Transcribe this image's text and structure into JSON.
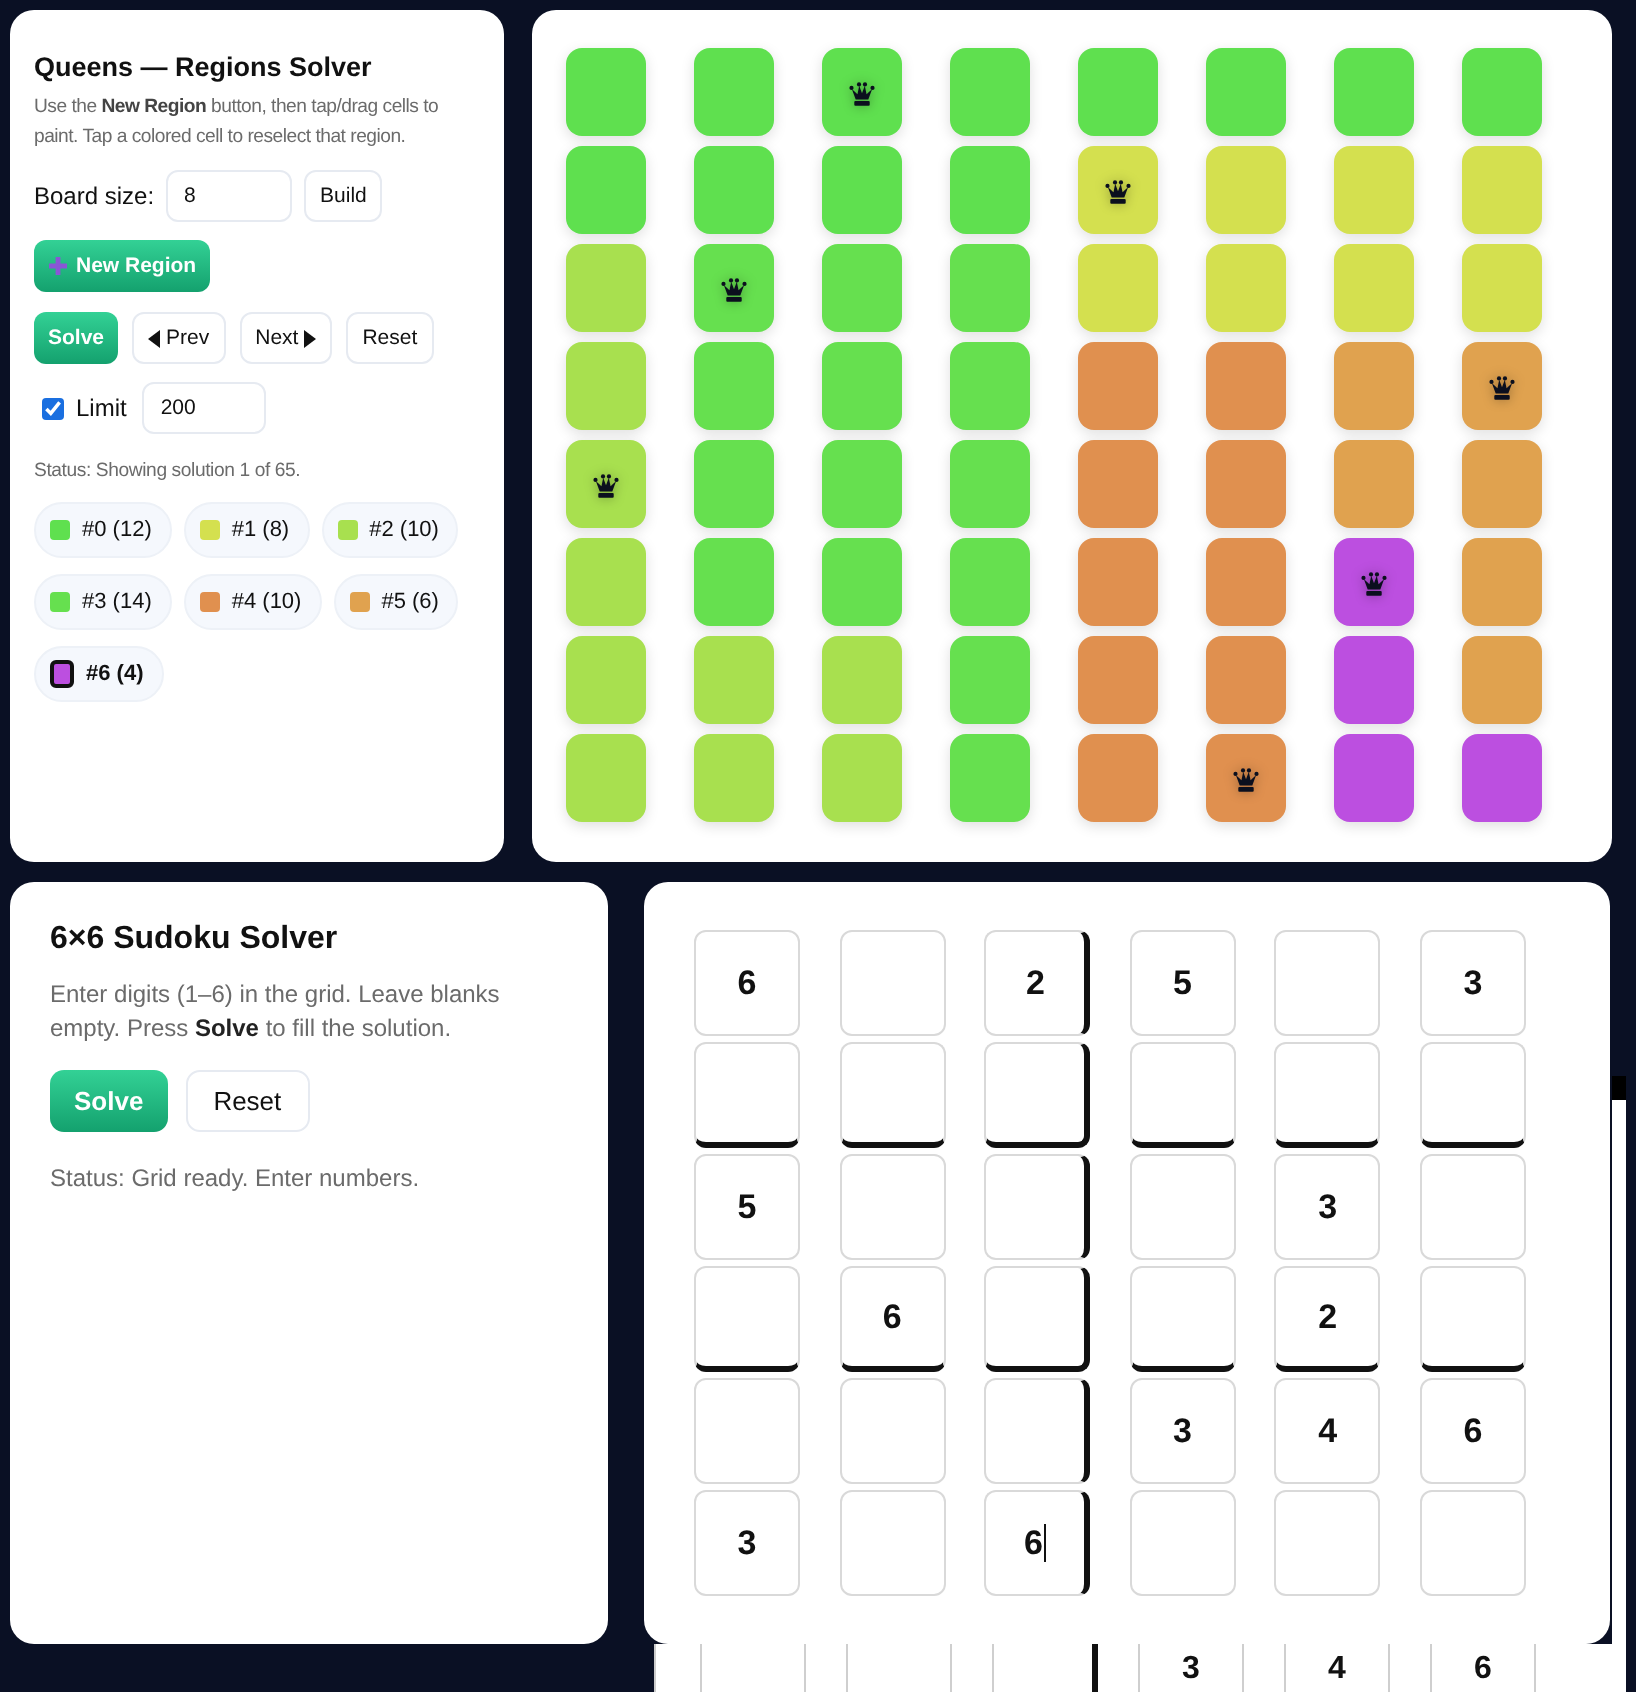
{
  "queens_panel": {
    "title": "Queens — Regions Solver",
    "description": "Use the **New Region** button, then tap/drag cells to paint. Tap a colored cell to reselect that region.",
    "board_size_label": "Board size:",
    "board_size": {
      "value": "8"
    },
    "build_button": "Build",
    "new_region_button": "New Region",
    "solve_button": "Solve",
    "prev_button": "Prev",
    "next_button": "Next",
    "reset_button": "Reset",
    "limit": {
      "label": "Limit",
      "checked": true,
      "value": "200"
    },
    "status": "Status: Showing solution 1 of 65.",
    "regions": [
      {
        "label": "#0 (12)",
        "color": "#5fe04f",
        "selected": false
      },
      {
        "label": "#1 (8)",
        "color": "#d4e04f",
        "selected": false
      },
      {
        "label": "#2 (10)",
        "color": "#a8e04f",
        "selected": false
      },
      {
        "label": "#3 (14)",
        "color": "#66e04f",
        "selected": false
      },
      {
        "label": "#4 (10)",
        "color": "#e0904f",
        "selected": false
      },
      {
        "label": "#5 (6)",
        "color": "#e0a24f",
        "selected": false
      },
      {
        "label": "#6 (4)",
        "color": "#bc4fe0",
        "selected": true
      }
    ]
  },
  "queens_board": {
    "rows": [
      {
        "cells": [
          {
            "color": "#5fe04f",
            "queen": false
          },
          {
            "color": "#5fe04f",
            "queen": false
          },
          {
            "color": "#5fe04f",
            "queen": true
          },
          {
            "color": "#5fe04f",
            "queen": false
          },
          {
            "color": "#5fe04f",
            "queen": false
          },
          {
            "color": "#5fe04f",
            "queen": false
          },
          {
            "color": "#5fe04f",
            "queen": false
          },
          {
            "color": "#5fe04f",
            "queen": false
          }
        ]
      },
      {
        "cells": [
          {
            "color": "#5fe04f",
            "queen": false
          },
          {
            "color": "#5fe04f",
            "queen": false
          },
          {
            "color": "#5fe04f",
            "queen": false
          },
          {
            "color": "#5fe04f",
            "queen": false
          },
          {
            "color": "#d4e04f",
            "queen": true
          },
          {
            "color": "#d4e04f",
            "queen": false
          },
          {
            "color": "#d4e04f",
            "queen": false
          },
          {
            "color": "#d4e04f",
            "queen": false
          }
        ]
      },
      {
        "cells": [
          {
            "color": "#a8e04f",
            "queen": false
          },
          {
            "color": "#66e04f",
            "queen": true
          },
          {
            "color": "#66e04f",
            "queen": false
          },
          {
            "color": "#66e04f",
            "queen": false
          },
          {
            "color": "#d4e04f",
            "queen": false
          },
          {
            "color": "#d4e04f",
            "queen": false
          },
          {
            "color": "#d4e04f",
            "queen": false
          },
          {
            "color": "#d4e04f",
            "queen": false
          }
        ]
      },
      {
        "cells": [
          {
            "color": "#a8e04f",
            "queen": false
          },
          {
            "color": "#66e04f",
            "queen": false
          },
          {
            "color": "#66e04f",
            "queen": false
          },
          {
            "color": "#66e04f",
            "queen": false
          },
          {
            "color": "#e0904f",
            "queen": false
          },
          {
            "color": "#e0904f",
            "queen": false
          },
          {
            "color": "#e0a24f",
            "queen": false
          },
          {
            "color": "#e0a24f",
            "queen": true
          }
        ]
      },
      {
        "cells": [
          {
            "color": "#a8e04f",
            "queen": true
          },
          {
            "color": "#66e04f",
            "queen": false
          },
          {
            "color": "#66e04f",
            "queen": false
          },
          {
            "color": "#66e04f",
            "queen": false
          },
          {
            "color": "#e0904f",
            "queen": false
          },
          {
            "color": "#e0904f",
            "queen": false
          },
          {
            "color": "#e0a24f",
            "queen": false
          },
          {
            "color": "#e0a24f",
            "queen": false
          }
        ]
      },
      {
        "cells": [
          {
            "color": "#a8e04f",
            "queen": false
          },
          {
            "color": "#66e04f",
            "queen": false
          },
          {
            "color": "#66e04f",
            "queen": false
          },
          {
            "color": "#66e04f",
            "queen": false
          },
          {
            "color": "#e0904f",
            "queen": false
          },
          {
            "color": "#e0904f",
            "queen": false
          },
          {
            "color": "#bc4fe0",
            "queen": true
          },
          {
            "color": "#e0a24f",
            "queen": false
          }
        ]
      },
      {
        "cells": [
          {
            "color": "#a8e04f",
            "queen": false
          },
          {
            "color": "#a8e04f",
            "queen": false
          },
          {
            "color": "#a8e04f",
            "queen": false
          },
          {
            "color": "#66e04f",
            "queen": false
          },
          {
            "color": "#e0904f",
            "queen": false
          },
          {
            "color": "#e0904f",
            "queen": false
          },
          {
            "color": "#bc4fe0",
            "queen": false
          },
          {
            "color": "#e0a24f",
            "queen": false
          }
        ]
      },
      {
        "cells": [
          {
            "color": "#a8e04f",
            "queen": false
          },
          {
            "color": "#a8e04f",
            "queen": false
          },
          {
            "color": "#a8e04f",
            "queen": false
          },
          {
            "color": "#66e04f",
            "queen": false
          },
          {
            "color": "#e0904f",
            "queen": false
          },
          {
            "color": "#e0904f",
            "queen": true
          },
          {
            "color": "#bc4fe0",
            "queen": false
          },
          {
            "color": "#bc4fe0",
            "queen": false
          }
        ]
      }
    ]
  },
  "sudoku_panel": {
    "title": "6×6 Sudoku Solver",
    "description": "Enter digits (1–6) in the grid. Leave blanks empty. Press **Solve** to fill the solution.",
    "solve_button": "Solve",
    "reset_button": "Reset",
    "status": "Status: Grid ready. Enter numbers."
  },
  "sudoku_board": {
    "rows": [
      {
        "cells": [
          {
            "value": "6",
            "focused": false
          },
          {
            "focused": false
          },
          {
            "value": "2",
            "focused": false
          },
          {
            "value": "5",
            "focused": false
          },
          {
            "focused": false
          },
          {
            "value": "3",
            "focused": false
          }
        ]
      },
      {
        "cells": [
          {
            "focused": false
          },
          {
            "focused": false
          },
          {
            "focused": false
          },
          {
            "focused": false
          },
          {
            "focused": false
          },
          {
            "focused": false
          }
        ]
      },
      {
        "cells": [
          {
            "value": "5",
            "focused": false
          },
          {
            "focused": false
          },
          {
            "focused": false
          },
          {
            "focused": false
          },
          {
            "value": "3",
            "focused": false
          },
          {
            "focused": false
          }
        ]
      },
      {
        "cells": [
          {
            "focused": false
          },
          {
            "value": "6",
            "focused": false
          },
          {
            "focused": false
          },
          {
            "focused": false
          },
          {
            "value": "2",
            "focused": false
          },
          {
            "focused": false
          }
        ]
      },
      {
        "cells": [
          {
            "focused": false
          },
          {
            "focused": false
          },
          {
            "focused": false
          },
          {
            "value": "3",
            "focused": false
          },
          {
            "value": "4",
            "focused": false
          },
          {
            "value": "6",
            "focused": false
          }
        ]
      },
      {
        "cells": [
          {
            "value": "3",
            "focused": false
          },
          {
            "focused": false
          },
          {
            "value": "6",
            "focused": true
          },
          {
            "focused": false
          },
          {
            "focused": false
          },
          {
            "focused": false
          }
        ]
      }
    ]
  },
  "background_grid": {
    "cells": [
      {},
      {},
      {},
      {
        "value": "3"
      },
      {
        "value": "4"
      },
      {
        "value": "6"
      }
    ]
  }
}
